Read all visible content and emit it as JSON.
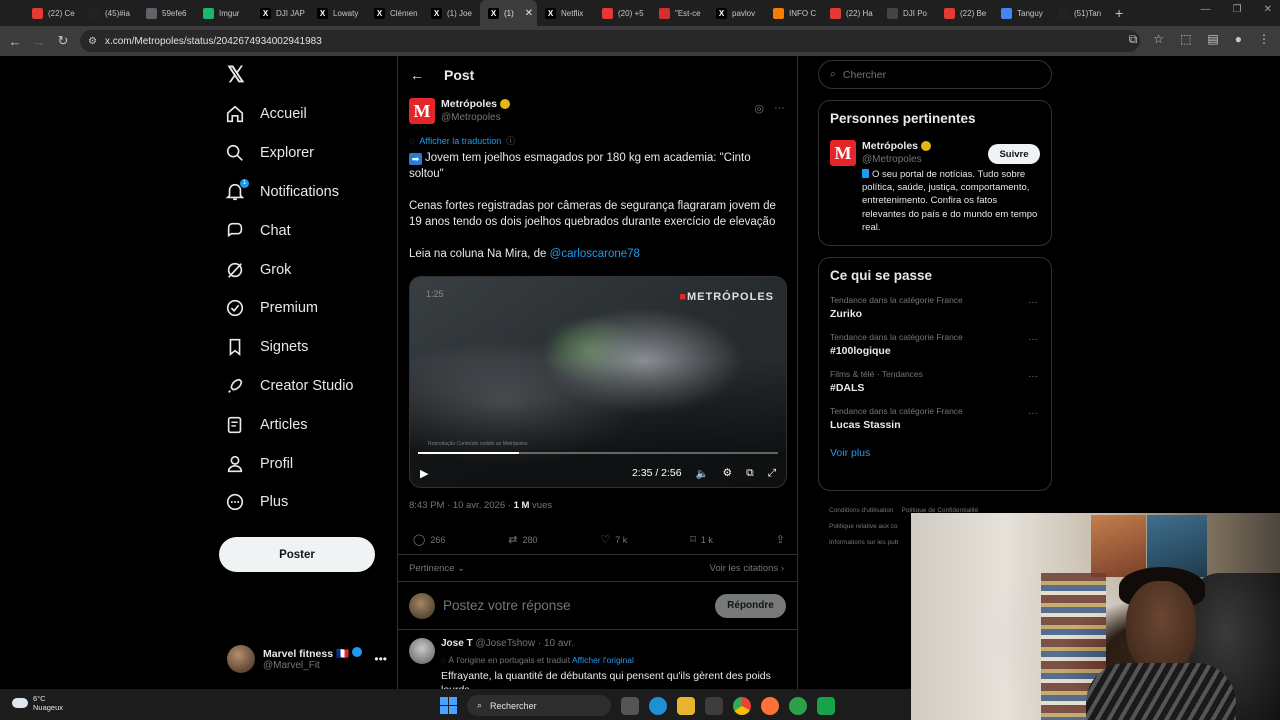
{
  "browser": {
    "tabs": [
      {
        "label": "(22) Ce",
        "icon": "youtube-icon",
        "color": "#e53935"
      },
      {
        "label": "(45)#ia",
        "icon": "tiktok-icon",
        "color": "#222222"
      },
      {
        "label": "59efe6",
        "icon": "globe-icon",
        "color": "#5f6368"
      },
      {
        "label": "Imgur",
        "icon": "imgur-icon",
        "color": "#1bb76e"
      },
      {
        "label": "DJI JAP",
        "icon": "x-icon",
        "color": "#000000"
      },
      {
        "label": "Lowaty",
        "icon": "x-icon",
        "color": "#000000"
      },
      {
        "label": "Clémen",
        "icon": "x-icon",
        "color": "#000000"
      },
      {
        "label": "(1) Joe",
        "icon": "x-icon",
        "color": "#000000"
      },
      {
        "label": "(1)",
        "icon": "x-icon",
        "color": "#000000",
        "active": true
      },
      {
        "label": "Netflix",
        "icon": "x-icon",
        "color": "#000000"
      },
      {
        "label": "(20) +5",
        "icon": "youtube-icon",
        "color": "#e53935"
      },
      {
        "label": "\"Est-ce",
        "icon": "e-icon",
        "color": "#d32f2f"
      },
      {
        "label": "pavlov",
        "icon": "x-icon",
        "color": "#000000"
      },
      {
        "label": "INFO C",
        "icon": "rss-icon",
        "color": "#f57c00"
      },
      {
        "label": "(22) Ha",
        "icon": "youtube-icon",
        "color": "#e53935"
      },
      {
        "label": "DJI Po",
        "icon": "dji-icon",
        "color": "#444444"
      },
      {
        "label": "(22) Be",
        "icon": "youtube-icon",
        "color": "#e53935"
      },
      {
        "label": "Tanguy",
        "icon": "google-icon",
        "color": "#4285f4"
      },
      {
        "label": "(51)Tan",
        "icon": "tiktok-icon",
        "color": "#222222"
      }
    ],
    "new_tab": "+",
    "url": "x.com/Metropoles/status/2042674934002941983"
  },
  "nav": {
    "logo": "𝕏",
    "items": [
      {
        "label": "Accueil",
        "icon": "home-icon"
      },
      {
        "label": "Explorer",
        "icon": "search-icon"
      },
      {
        "label": "Notifications",
        "icon": "bell-icon",
        "badge": "1"
      },
      {
        "label": "Chat",
        "icon": "chat-icon"
      },
      {
        "label": "Grok",
        "icon": "grok-icon"
      },
      {
        "label": "Premium",
        "icon": "premium-icon"
      },
      {
        "label": "Signets",
        "icon": "bookmark-icon"
      },
      {
        "label": "Creator Studio",
        "icon": "rocket-icon"
      },
      {
        "label": "Articles",
        "icon": "article-icon"
      },
      {
        "label": "Profil",
        "icon": "user-icon"
      },
      {
        "label": "Plus",
        "icon": "more-circle-icon"
      }
    ],
    "post_button": "Poster",
    "account": {
      "name": "Marvel fitness 🇫🇷",
      "handle": "@Marvel_Fit"
    }
  },
  "main": {
    "header": "Post",
    "tweet": {
      "author": "Metrópoles",
      "handle": "@Metropoles",
      "translate": "Afficher la traduction",
      "headline": "Jovem tem joelhos esmagados por 180 kg em academia: \"Cinto soltou\"",
      "body": "Cenas fortes registradas por câmeras de segurança flagraram jovem de 19 anos tendo os dois joelhos quebrados durante exercício de elevação",
      "link_prefix": "Leia na coluna Na Mira, de ",
      "mention": "@carloscarone78",
      "video": {
        "top_time": "1:25",
        "brand": "METRÓPOLES",
        "credit": "Reprodução\nConteúdo cedido ao Metrópoles",
        "time": "2:35 / 2:56",
        "progress": 0.28
      },
      "timestamp": "8:43 PM · 10 avr. 2026 · ",
      "views_count": "1 M",
      "views_label": " vues",
      "stats": {
        "replies": "266",
        "reposts": "280",
        "likes": "7 k",
        "bookmarks": "1 k"
      },
      "sort": "Pertinence",
      "quotes": "Voir les citations"
    },
    "reply": {
      "placeholder": "Postez votre réponse",
      "button": "Répondre"
    },
    "comment": {
      "author": "Jose T",
      "handle": "@JoseTshow · 10 avr.",
      "trans_prefix": "À l'origine en portugais et traduit ",
      "trans_link": "Afficher l'original",
      "text": "Effrayante, la quantité de débutants qui pensent qu'ils gèrent des poids lourds"
    }
  },
  "sidebar": {
    "search_placeholder": "Chercher",
    "related": {
      "title": "Personnes pertinentes",
      "name": "Metrópoles",
      "handle": "@Metropoles",
      "follow": "Suivre",
      "bio": "O seu portal de notícias. Tudo sobre política, saúde, justiça, comportamento, entretenimento. Confira os fatos relevantes do país e do mundo em tempo real."
    },
    "trends": {
      "title": "Ce qui se passe",
      "items": [
        {
          "category": "Tendance dans la catégorie France",
          "name": "Zuriko"
        },
        {
          "category": "Tendance dans la catégorie France",
          "name": "#100logique"
        },
        {
          "category": "Films & télé · Tendances",
          "name": "#DALS"
        },
        {
          "category": "Tendance dans la catégorie France",
          "name": "Lucas Stassin"
        }
      ],
      "see_more": "Voir plus"
    },
    "footer": [
      "Conditions d'utilisation",
      "Politique de Confidentialité",
      "Politique relative aux co",
      "Informations sur les pub"
    ]
  },
  "taskbar": {
    "temp": "6°C",
    "weather": "Nuageux",
    "search": "Rechercher"
  }
}
